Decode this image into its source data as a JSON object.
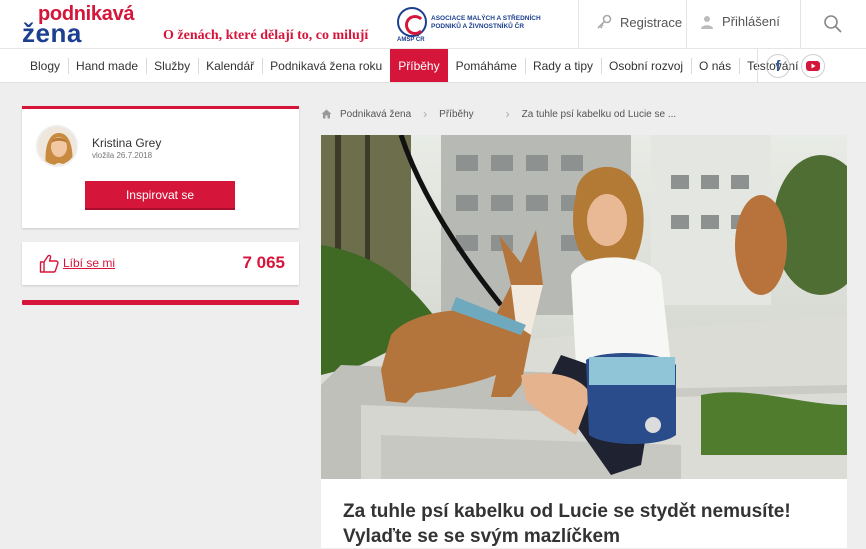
{
  "header": {
    "logo_line1": "podnikavá",
    "logo_line2": "žena",
    "tagline": "O ženách, které dělají to, co milují",
    "partner_abbr": "AMSP ČR",
    "partner_text": "ASOCIACE MALÝCH A STŘEDNÍCH PODNIKŮ A ŽIVNOSTNÍKŮ ČR",
    "register_label": "Registrace",
    "login_label": "Přihlášení"
  },
  "nav": {
    "items": [
      "Blogy",
      "Hand made",
      "Služby",
      "Kalendář",
      "Podnikavá žena roku",
      "Příběhy",
      "Pomáháme",
      "Rady a tipy",
      "Osobní rozvoj",
      "O nás",
      "Testování"
    ],
    "active_index": 5,
    "social": [
      "facebook-icon",
      "youtube-icon"
    ]
  },
  "author": {
    "name": "Kristina Grey",
    "date": "vložila 26.7.2018",
    "button_label": "Inspirovat se"
  },
  "likes": {
    "label": "Líbí se mi",
    "count": "7 065"
  },
  "breadcrumb": [
    "Podnikavá žena",
    "Příběhy",
    "Za tuhle psí kabelku od Lucie se ..."
  ],
  "article": {
    "title": "Za tuhle psí kabelku od Lucie se stydět nemusíte! Vylaďte se se svým mazlíčkem"
  },
  "colors": {
    "accent": "#d5163a",
    "brand_blue": "#1d3f8f"
  }
}
